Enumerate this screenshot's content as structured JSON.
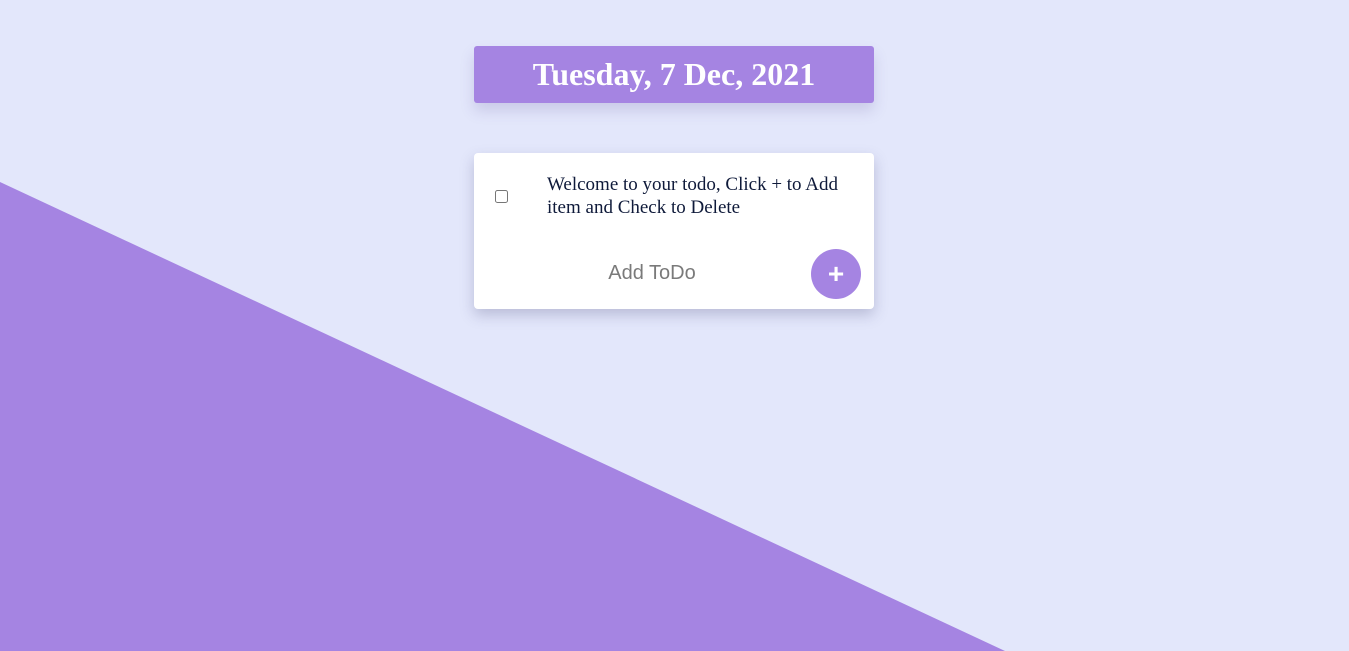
{
  "colors": {
    "background": "#e3e7fb",
    "accent": "#a584e2",
    "card": "#ffffff",
    "text": "#0f1a3a"
  },
  "header": {
    "date": "Tuesday, 7 Dec, 2021"
  },
  "todos": [
    {
      "text": "Welcome to your todo, Click + to Add item and Check to Delete",
      "checked": false
    }
  ],
  "add_todo": {
    "placeholder": "Add ToDo",
    "button_icon": "plus-icon",
    "button_label": "+"
  }
}
